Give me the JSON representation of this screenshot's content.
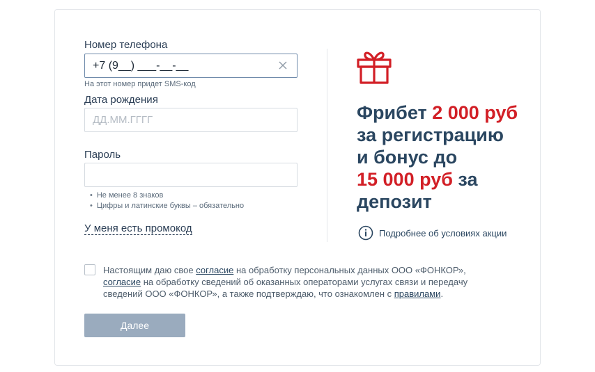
{
  "form": {
    "phone_label": "Номер телефона",
    "phone_value": "+7 (9__) ___-__-__",
    "phone_hint": "На этот номер придет SMS-код",
    "birth_label": "Дата рождения",
    "birth_placeholder": "ДД.ММ.ГГГГ",
    "password_label": "Пароль",
    "password_rules": [
      "Не менее 8 знаков",
      "Цифры и латинские буквы – обязательно"
    ],
    "promo_link": "У меня есть промокод"
  },
  "promo": {
    "line1_a": "Фрибет ",
    "line1_b": "2 000 руб",
    "line2": "за регистрацию",
    "line3": "и бонус до",
    "line4_a": "15 000 руб",
    "line4_b": " за",
    "line5": "депозит",
    "info_link": "Подробнее об условиях акции"
  },
  "consent": {
    "t1": "Настоящим даю свое ",
    "link1": "согласие",
    "t2": " на обработку персональных данных ООО «ФОНКОР»,",
    "link2": "согласие",
    "t3": " на обработку сведений об оказанных операторами услугах связи и передачу сведений ООО «ФОНКОР», а также подтверждаю, что ознакомлен с ",
    "link3": "правилами",
    "t4": "."
  },
  "submit_label": "Далее",
  "colors": {
    "accent_red": "#d21f26",
    "heading_blue": "#2a4660",
    "button": "#9aabbe"
  },
  "icons": [
    "close-icon",
    "gift-icon",
    "info-icon"
  ]
}
